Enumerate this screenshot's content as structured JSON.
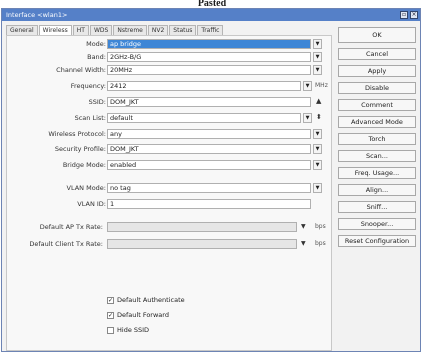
{
  "caption": "Pasted",
  "window": {
    "title": "Interface <wlan1>"
  },
  "tabs": [
    "General",
    "Wireless",
    "HT",
    "WDS",
    "Nstreme",
    "NV2",
    "Status",
    "Traffic"
  ],
  "fields": {
    "mode": {
      "label": "Mode:",
      "value": "ap bridge"
    },
    "band": {
      "label": "Band:",
      "value": "2GHz-B/G"
    },
    "channel_width": {
      "label": "Channel Width:",
      "value": "20MHz"
    },
    "frequency": {
      "label": "Frequency:",
      "value": "2412",
      "unit": "MHz"
    },
    "ssid": {
      "label": "SSID:",
      "value": "DOM_JKT"
    },
    "scan_list": {
      "label": "Scan List:",
      "value": "default"
    },
    "wireless_protocol": {
      "label": "Wireless Protocol:",
      "value": "any"
    },
    "security_profile": {
      "label": "Security Profile:",
      "value": "DOM_JKT"
    },
    "bridge_mode": {
      "label": "Bridge Mode:",
      "value": "enabled"
    },
    "vlan_mode": {
      "label": "VLAN Mode:",
      "value": "no tag"
    },
    "vlan_id": {
      "label": "VLAN ID:",
      "value": "1"
    },
    "default_ap_tx_rate": {
      "label": "Default AP Tx Rate:",
      "value": "",
      "unit": "bps"
    },
    "default_client_tx_rate": {
      "label": "Default Client Tx Rate:",
      "value": "",
      "unit": "bps"
    }
  },
  "checkboxes": [
    {
      "label": "Default Authenticate",
      "checked": true
    },
    {
      "label": "Default Forward",
      "checked": true
    },
    {
      "label": "Hide SSID",
      "checked": false
    }
  ],
  "buttons": [
    "OK",
    "Cancel",
    "Apply",
    "Disable",
    "Comment",
    "Advanced Mode",
    "Torch",
    "Scan...",
    "Freq. Usage...",
    "Align...",
    "Sniff...",
    "Snooper...",
    "Reset Configuration"
  ],
  "icons": {
    "dropdown": "dropdown-arrow-icon",
    "up": "up-arrow-icon",
    "updown": "up-down-icon",
    "close": "close-icon"
  },
  "colors": {
    "titlebar": "#5580c8",
    "selected_field": "#3e86d6"
  }
}
